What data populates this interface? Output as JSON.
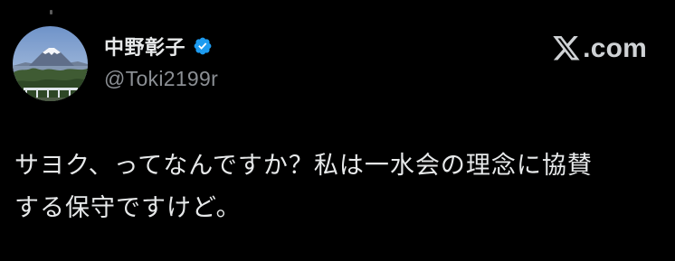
{
  "author": {
    "display_name": "中野彰子",
    "handle": "@Toki2199r",
    "verified": true,
    "avatar": "mount-fuji-photo"
  },
  "site_logo": {
    "icon": "x-logo-icon",
    "suffix": ".com"
  },
  "post": {
    "lines": [
      "サヨク、ってなんですか？私は一水会の理念に協賛",
      "する保守ですけど。"
    ]
  },
  "colors": {
    "background": "#000000",
    "text": "#e7e9ea",
    "secondary_text": "#8b8f94",
    "verified_blue": "#1d9bf0"
  }
}
